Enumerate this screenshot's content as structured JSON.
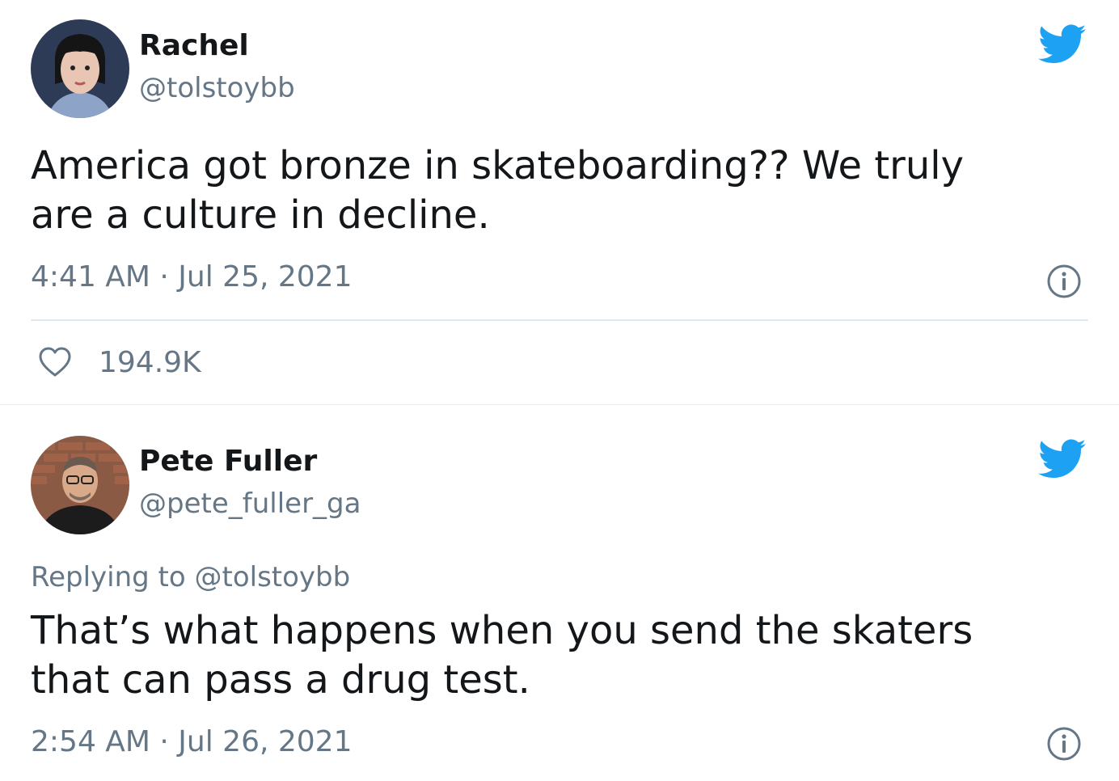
{
  "tweets": [
    {
      "name": "Rachel",
      "handle": "@tolstoybb",
      "text_lines": [
        "America got bronze in skateboarding?? We truly",
        "are a culture in decline."
      ],
      "time": "4:41 AM · Jul 25, 2021",
      "likes": "194.9K",
      "icon_bird": "twitter-bird-icon",
      "icon_info": "info-icon",
      "icon_like": "heart-icon"
    },
    {
      "name": "Pete Fuller",
      "handle": "@pete_fuller_ga",
      "replying_prefix": "Replying to",
      "replying_handle": "@tolstoybb",
      "text_lines": [
        "That’s what happens when you send the skaters",
        "that can pass a drug test."
      ],
      "time": "2:54 AM · Jul 26, 2021",
      "icon_bird": "twitter-bird-icon",
      "icon_info": "info-icon"
    }
  ],
  "colors": {
    "bird": "#1da1f2",
    "meta_text": "#657786",
    "body_text": "#14171a"
  }
}
